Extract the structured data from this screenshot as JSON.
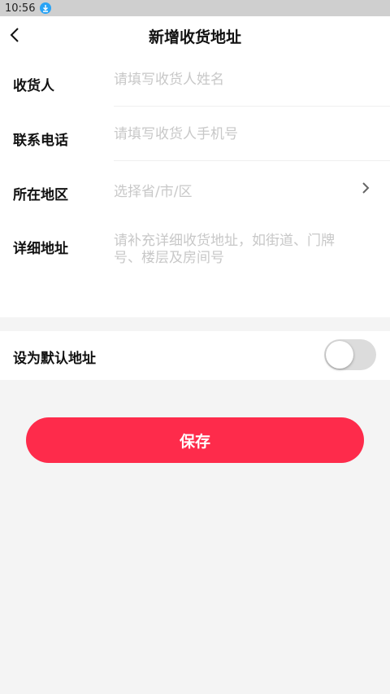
{
  "status_bar": {
    "time": "10:56",
    "notification_icon": "download-icon"
  },
  "header": {
    "back_icon": "chevron-left-icon",
    "title": "新增收货地址"
  },
  "form": {
    "recipient": {
      "label": "收货人",
      "placeholder": "请填写收货人姓名"
    },
    "phone": {
      "label": "联系电话",
      "placeholder": "请填写收货人手机号"
    },
    "region": {
      "label": "所在地区",
      "placeholder": "选择省/市/区",
      "icon": "chevron-right-icon"
    },
    "detail": {
      "label": "详细地址",
      "placeholder": "请补充详细收货地址，如街道、门牌号、楼层及房间号"
    }
  },
  "default_address": {
    "label": "设为默认地址",
    "enabled": false
  },
  "save_button": {
    "label": "保存",
    "color": "#fe2b4b"
  }
}
